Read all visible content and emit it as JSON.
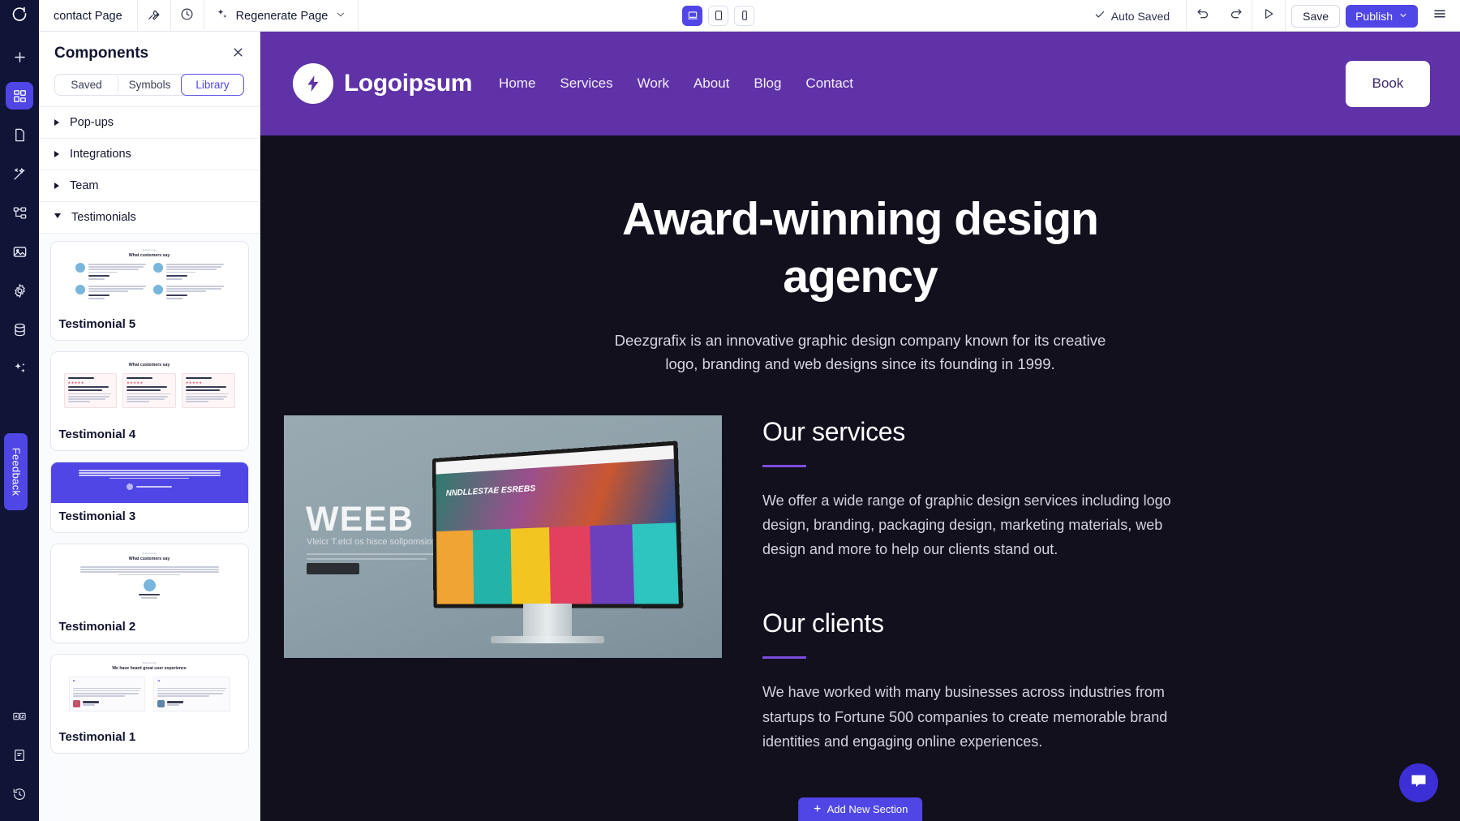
{
  "topbar": {
    "page_name": "contact Page",
    "wrench_icon": "wrench-icon",
    "history_icon": "clock-history-icon",
    "regenerate_label": "Regenerate Page",
    "regenerate_icon": "sparkles-icon",
    "chevron_icon": "chevron-down-icon",
    "devices": [
      {
        "name": "desktop",
        "icon": "laptop-icon",
        "active": true
      },
      {
        "name": "tablet",
        "icon": "tablet-icon",
        "active": false
      },
      {
        "name": "mobile",
        "icon": "phone-icon",
        "active": false
      }
    ],
    "autosave_label": "Auto Saved",
    "check_icon": "check-icon",
    "undo_icon": "undo-icon",
    "redo_icon": "redo-icon",
    "preview_icon": "play-preview-icon",
    "save_label": "Save",
    "publish_label": "Publish",
    "menu_icon": "hamburger-menu-icon",
    "accent": "#4f46e5"
  },
  "rail": {
    "logo_icon": "app-logo-icon",
    "items": [
      {
        "name": "add",
        "icon": "plus-icon",
        "active": false
      },
      {
        "name": "components",
        "icon": "grid-blocks-icon",
        "active": true
      },
      {
        "name": "pages",
        "icon": "page-icon",
        "active": false
      },
      {
        "name": "design",
        "icon": "magic-wand-icon",
        "active": false
      },
      {
        "name": "layers",
        "icon": "sitemap-icon",
        "active": false
      },
      {
        "name": "media",
        "icon": "image-icon",
        "active": false
      },
      {
        "name": "settings",
        "icon": "gear-icon",
        "active": false
      },
      {
        "name": "database",
        "icon": "database-icon",
        "active": false
      },
      {
        "name": "ai",
        "icon": "sparkles-icon",
        "active": false
      }
    ],
    "feedback_label": "Feedback",
    "bottom_items": [
      {
        "name": "translate",
        "icon": "translate-az-icon"
      },
      {
        "name": "docs",
        "icon": "book-icon"
      },
      {
        "name": "version-history",
        "icon": "clock-revert-icon"
      }
    ]
  },
  "panel": {
    "title": "Components",
    "close_icon": "close-icon",
    "tabs": [
      {
        "label": "Saved",
        "active": false
      },
      {
        "label": "Symbols",
        "active": false
      },
      {
        "label": "Library",
        "active": true
      }
    ],
    "accordions": [
      {
        "label": "Pop-ups",
        "open": false
      },
      {
        "label": "Integrations",
        "open": false
      },
      {
        "label": "Team",
        "open": false
      },
      {
        "label": "Testimonials",
        "open": true
      }
    ],
    "cards": [
      {
        "label": "Testimonial 5",
        "thumb_heading": "What customers say",
        "thumb_eyebrow": "Testimonial",
        "variant": "avatars-grid"
      },
      {
        "label": "Testimonial 4",
        "thumb_heading": "What customers say",
        "thumb_eyebrow": "",
        "variant": "rating-cards"
      },
      {
        "label": "Testimonial 3",
        "thumb_heading": "",
        "thumb_eyebrow": "",
        "variant": "purple-quote"
      },
      {
        "label": "Testimonial 2",
        "thumb_heading": "What customers say",
        "thumb_eyebrow": "Testimonial",
        "variant": "single-center"
      },
      {
        "label": "Testimonial 1",
        "thumb_heading": "We have heard great user experience",
        "thumb_eyebrow": "Testimonial",
        "variant": "quote-pair"
      }
    ]
  },
  "canvas": {
    "site": {
      "brand_name": "Logoipsum",
      "brand_icon": "lightning-bolt-icon",
      "nav_links": [
        "Home",
        "Services",
        "Work",
        "About",
        "Blog",
        "Contact"
      ],
      "cta_label": "Book",
      "nav_bg": "#5f32a8",
      "page_bg": "#12101d",
      "hero_title": "Award-winning design agency",
      "hero_sub": "Deezgrafix is an innovative graphic design company known for its creative logo, branding and web designs since its founding in 1999.",
      "image": {
        "name": "imac-website-mockup",
        "word": "WEEB",
        "sub": "Vleicr T.etcl os hisce sollpomsio x."
      },
      "blocks": [
        {
          "heading": "Our services",
          "body": "We offer a wide range of graphic design services including logo design, branding, packaging design, marketing materials, web design and more to help our clients stand out."
        },
        {
          "heading": "Our clients",
          "body": "We have worked with many businesses across industries from startups to Fortune 500 companies to create memorable brand identities and engaging online experiences."
        }
      ],
      "rule_color": "#7c4de0"
    },
    "add_section_label": "Add New Section",
    "add_section_icon": "plus-icon",
    "chat_icon": "chat-bubble-icon"
  }
}
